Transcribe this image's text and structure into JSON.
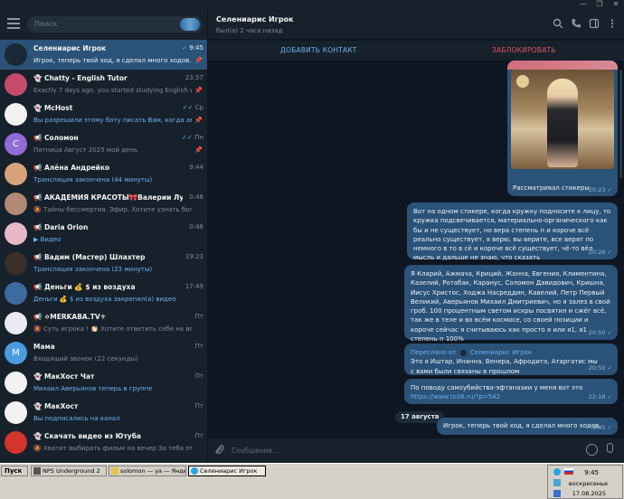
{
  "window": {
    "min": "—",
    "max": "❐",
    "close": "✕"
  },
  "sidebar": {
    "search_placeholder": "Поиск",
    "chats": [
      {
        "name": "Селениарис Игрок",
        "time": "9:45",
        "message": "Игрок, теперь твой ход, я сделал много ходов.",
        "status": "✓",
        "pinned": true,
        "active": true,
        "avatar_color": "#1b2835"
      },
      {
        "name": "👻 Chatty - English Tutor",
        "time": "23:57",
        "message": "Exactly 7 days ago, you started studying English with ...",
        "pinned": true,
        "avatar_color": "#c64a6a"
      },
      {
        "name": "👻 McHost",
        "time": "Ср",
        "message": "Вы разрешили этому боту писать Вам, когда авто...",
        "status": "✓✓",
        "pinned": true,
        "blue_message": true,
        "avatar_color": "#f2f2f2"
      },
      {
        "name": "📢 Соломон",
        "time": "Пн",
        "message": "Пятница Август 2025 мой день",
        "status": "✓✓",
        "pinned": true,
        "avatar_letter": "C",
        "avatar_color": "#8f6cd6"
      },
      {
        "name": "📢 Алёна Андрейко",
        "time": "9:44",
        "message": "Трансляция закончена (44 минуты)",
        "blue_message": true,
        "avatar_color": "#d9a27a"
      },
      {
        "name": "📢 АКАДЕМИЯ КРАСОТЫ🎀Валерии Лукьяново...",
        "time": "0:46",
        "message": "🔕 Тайны бессмертия. Эфир. Хотите узнать больш...",
        "avatar_color": "#b08a74"
      },
      {
        "name": "📢 Daria Orion",
        "time": "0:46",
        "message": "▶ Видео",
        "blue_message": true,
        "avatar_color": "#e7b8c8"
      },
      {
        "name": "📢 Вадим (Мастер) Шлахтер",
        "time": "19:23",
        "message": "Трансляция закончена (23 минуты)",
        "blue_message": true,
        "avatar_color": "#3b2f2a"
      },
      {
        "name": "📢 Деньги 💰 $ из воздуха",
        "time": "17:49",
        "message": "Деньги 💰 $ из воздуха закрепил(а) видео",
        "blue_message": true,
        "avatar_color": "#3d6ba0"
      },
      {
        "name": "📢 ✡MERKABA.TV⚜",
        "time": "Пт",
        "message": "🔕 Суть  игрока ! 👏🏻 Хотите ответить себе на вопр...",
        "avatar_color": "#eaeaf5"
      },
      {
        "name": "Мама",
        "time": "Пт",
        "message": "Входящий звонок (22 секунды)",
        "avatar_letter": "M",
        "avatar_color": "#4a9be0"
      },
      {
        "name": "👻 МакХост Чат",
        "time": "Пт",
        "message": "Михаил Аверьянов теперь в группе",
        "blue_message": true,
        "avatar_color": "#f2f2f2"
      },
      {
        "name": "👻 МакХост",
        "time": "Пт",
        "message": "Вы подписались на канал",
        "blue_message": true,
        "avatar_color": "#f2f2f2"
      },
      {
        "name": "👻 Скачать видео из Ютуба",
        "time": "Пт",
        "message": "🔕 Хватит выбирать фильм на вечер  За тебя это уже ...",
        "avatar_color": "#d3342c"
      }
    ]
  },
  "header": {
    "title": "Селениарис Игрок",
    "subtitle": "был(а) 2 часа назад",
    "add_contact": "ДОБАВИТЬ КОНТАКТ",
    "block": "ЗАБЛОКИРОВАТЬ"
  },
  "messages": {
    "photo_caption": "Рассматривал стикеры",
    "photo_time": "20:23",
    "m1_text": "Вот на одном стикере, когда кружку подносите к лицу, то кружка подсвечивается, материально-органического как бы и не существует, но вера степень п и короче всё реально существует, я верю, вы верите, все верят по немного в то в сё и короче всё существует, чё-то вёл мысль и дальше не знаю, что сказать",
    "m1_time": "20:26",
    "m2_text": "Я Кларий, Ажмача, Криций, Жанна, Евгения, Климентина, Казелий, Ротабак, Каранус, Соломон Давидович, Кришна, Иисус Христос, Ходжа Насреддин, Кавелий, Петр Первый Великий, Аверьянов Михаил Дмитриевич, но я залез в свой гроб. 100 процентным светом искры посвятил и сжёг всё, так же в теле и во всём космосе, со своей позиции и короче сейчас я считываюсь как просто я или я1, я1 степень п 100%",
    "m2_time": "20:50",
    "fwd_label": "Переслано от",
    "fwd_from": "Селениарис Игрок",
    "m3_text": "Это я Иштар, Инанна, Венера, Афродита, Атаргатис мы с вами были связаны в прошлом",
    "m3_time": "20:50",
    "m4_text": "По поводу самоубийства-эфтаназии у меня вот это",
    "m4_link": "https://www.to36.ru/?p=542",
    "m4_time": "22:18",
    "date_divider": "17 августа",
    "m5_text": "Игрок, теперь твой ход, я сделал много ходов.",
    "m5_time": "9:45"
  },
  "composer": {
    "placeholder": "Сообщение..."
  },
  "taskbar": {
    "start": "Пуск",
    "tasks": [
      "NPS Underground 2",
      "solomon — ya — Яндекс...",
      "Селениарис Игрок"
    ],
    "time": "9:45",
    "day": "воскресенье",
    "date": "17.08.2025"
  }
}
